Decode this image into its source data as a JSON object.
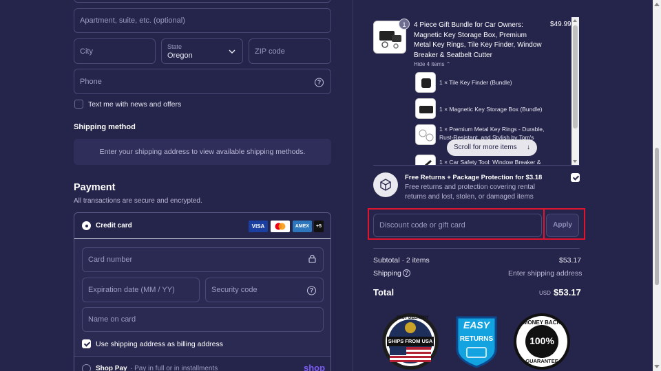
{
  "address": {
    "apartment_placeholder": "Apartment, suite, etc. (optional)",
    "city_placeholder": "City",
    "state_label": "State",
    "state_value": "Oregon",
    "zip_placeholder": "ZIP code",
    "phone_placeholder": "Phone",
    "text_me_label": "Text me with news and offers"
  },
  "shipping": {
    "heading": "Shipping method",
    "message": "Enter your shipping address to view available shipping methods."
  },
  "payment": {
    "heading": "Payment",
    "subheading": "All transactions are secure and encrypted.",
    "credit_card_label": "Credit card",
    "cards": [
      "VISA",
      "",
      "AMEX",
      "+5"
    ],
    "card_number_placeholder": "Card number",
    "expiration_placeholder": "Expiration date (MM / YY)",
    "security_code_placeholder": "Security code",
    "name_on_card_placeholder": "Name on card",
    "billing_same_label": "Use shipping address as billing address",
    "shop_pay_label": "Shop Pay",
    "shop_pay_desc": "· Pay in full or in installments",
    "shop_pay_logo": "shop"
  },
  "cart": {
    "item_title": "4 Piece Gift Bundle for Car Owners: Magnetic Key Storage Box, Premium Metal Key Rings, Tile Key Finder, Window Breaker & Seatbelt Cutter",
    "item_price": "$49.99",
    "item_qty": "1",
    "hide_items": "Hide 4 items",
    "sub_items": [
      "1 × Tile Key Finder (Bundle)",
      "1 × Magnetic Key Storage Box (Bundle)",
      "1 × Premium Metal Key Rings - Durable, Rust-Resistant, and Stylish by Tom's",
      "1 × Car Safety Tool: Window Breaker &"
    ],
    "scroll_hint": "Scroll for more items"
  },
  "protection": {
    "title": "Free Returns + Package Protection for $3.18",
    "desc": "Free returns and protection covering rental returns and lost, stolen, or damaged items"
  },
  "discount": {
    "placeholder": "Discount code or gift card",
    "apply_label": "Apply"
  },
  "summary": {
    "subtotal_label": "Subtotal · 2 items",
    "subtotal_value": "$53.17",
    "shipping_label": "Shipping",
    "shipping_value": "Enter shipping address",
    "total_label": "Total",
    "currency": "USD",
    "total_value": "$53.17"
  },
  "seals": {
    "fast_delivery": {
      "top": "FAST DELIVERY",
      "middle": "SHIPS FROM USA"
    },
    "easy_returns": {
      "top": "EASY",
      "bottom": "RETURNS"
    },
    "money_back": {
      "top": "MONEY BACK",
      "middle": "100%",
      "bottom": "GUARANTEE"
    }
  },
  "colors": {
    "background": "#25244a",
    "highlight": "#e0142d",
    "panel": "#2f2e5a"
  }
}
